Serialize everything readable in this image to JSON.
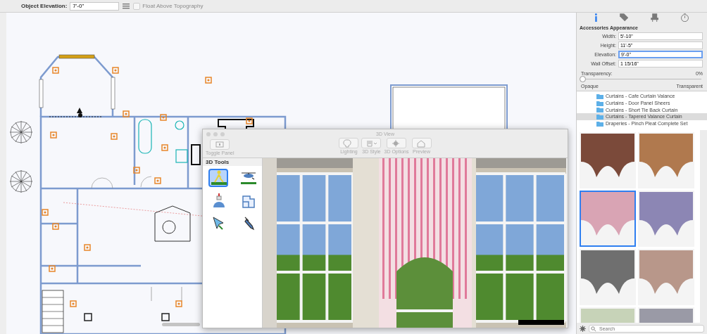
{
  "toolbar": {
    "label": "Object Elevation:",
    "value": "7'-0\"",
    "float_checkbox": {
      "label": "Float Above Topography",
      "checked": false,
      "disabled": true
    }
  },
  "inspector": {
    "tabs": [
      {
        "kind": "info",
        "selected": true
      },
      {
        "kind": "tag",
        "selected": false
      },
      {
        "kind": "chair",
        "selected": false
      },
      {
        "kind": "timer",
        "selected": false
      }
    ],
    "heading": "Accessories Appearance",
    "fields": [
      {
        "label": "Width:",
        "value": "5'-10\"",
        "focused": false
      },
      {
        "label": "Height:",
        "value": "11'-5\"",
        "focused": false
      },
      {
        "label": "Elevation:",
        "value": "9'-0\"",
        "focused": true
      },
      {
        "label": "Wall Offset:",
        "value": "1 15/16\"",
        "focused": false
      }
    ],
    "transparency": {
      "label": "Transparency:",
      "reading": "0%",
      "level": 0,
      "min_label": "Opaque",
      "max_label": "Transparent"
    }
  },
  "library": {
    "items": [
      {
        "label": "Curtains - Cafe Curtain Valance",
        "selected": false
      },
      {
        "label": "Curtains - Door Panel Sheers",
        "selected": false
      },
      {
        "label": "Curtains - Short Tie Back Curtain",
        "selected": false
      },
      {
        "label": "Curtains - Tapered Valance Curtain",
        "selected": true
      },
      {
        "label": "Draperies - Pinch Pleat Complete Set",
        "selected": false
      }
    ],
    "thumbnails": [
      {
        "color": "#7b4a3a",
        "selected": false
      },
      {
        "color": "#b0794e",
        "selected": false
      },
      {
        "color": "#d9a4b4",
        "selected": true
      },
      {
        "color": "#8c86b4",
        "selected": false
      },
      {
        "color": "#6f6f6f",
        "selected": false
      },
      {
        "color": "#b8978a",
        "selected": false
      },
      {
        "color": "#c7d3b8",
        "selected": false
      },
      {
        "color": "#9a9aa6",
        "selected": false
      }
    ],
    "search": {
      "placeholder": "Search"
    }
  },
  "view_window": {
    "title": "3D View",
    "toggle": "Toggle Panel",
    "buttons": [
      {
        "kind": "lighting",
        "label": "Lighting"
      },
      {
        "kind": "style",
        "label": "3D Style"
      },
      {
        "kind": "options",
        "label": "3D Options"
      },
      {
        "kind": "preview",
        "label": "Preview"
      }
    ],
    "panel_title": "3D Tools",
    "tools": [
      {
        "kind": "walk",
        "selected": true
      },
      {
        "kind": "aerial",
        "selected": false
      },
      {
        "kind": "dollhouse",
        "selected": false
      },
      {
        "kind": "floorplan",
        "selected": false
      },
      {
        "kind": "select",
        "selected": false
      },
      {
        "kind": "eyedropper",
        "selected": false
      }
    ]
  }
}
